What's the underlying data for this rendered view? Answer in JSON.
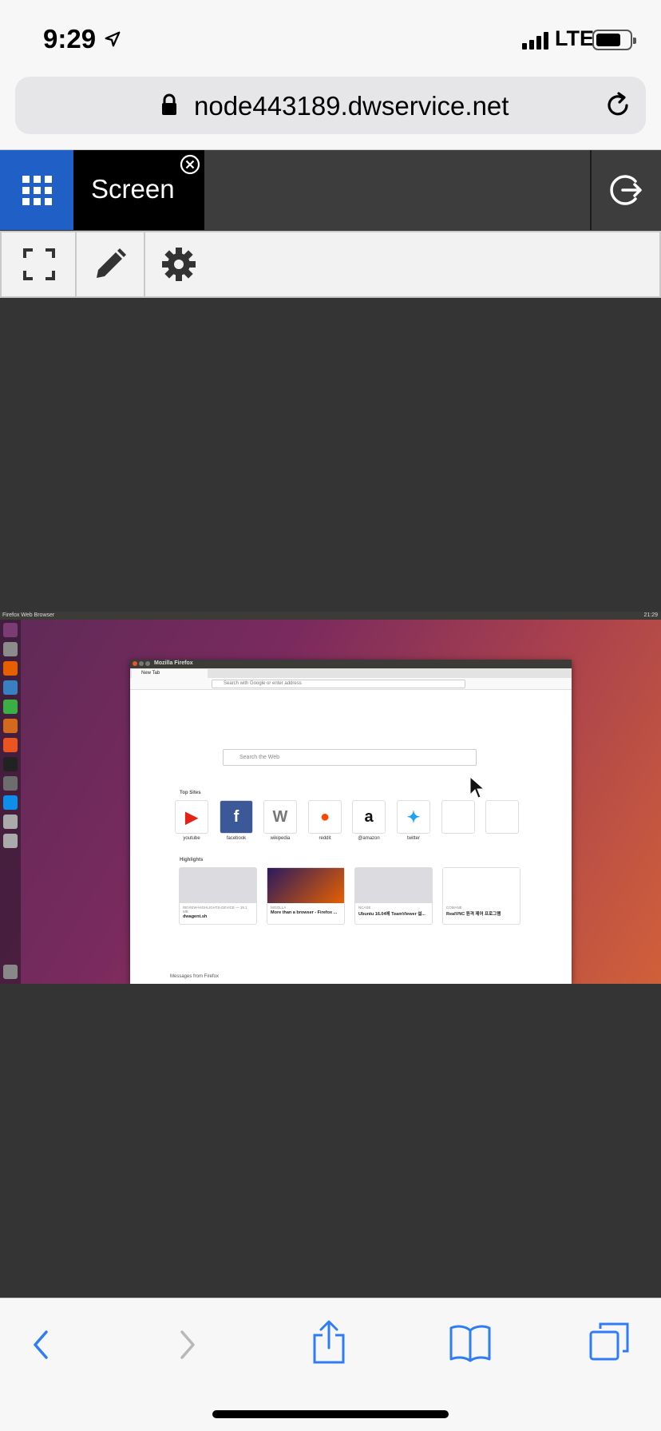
{
  "status_bar": {
    "time": "9:29",
    "network": "LTE"
  },
  "url_bar": {
    "url": "node443189.dwservice.net"
  },
  "app": {
    "active_tab": "Screen"
  },
  "remote_desktop": {
    "top_panel_title": "Firefox Web Browser",
    "top_panel_clock": "21:29",
    "window_title": "Mozilla Firefox",
    "tab_title": "New Tab",
    "address_placeholder": "Search with Google or enter address",
    "search_placeholder": "Search the Web",
    "top_sites_label": "Top Sites",
    "top_sites": [
      {
        "name": "youtube",
        "icon": "youtube-icon",
        "color": "#e62117"
      },
      {
        "name": "facebook",
        "icon": "facebook-icon",
        "color": "#3b5998"
      },
      {
        "name": "wikipedia",
        "icon": "wikipedia-icon",
        "color": "#777777"
      },
      {
        "name": "reddit",
        "icon": "reddit-icon",
        "color": "#ff4500"
      },
      {
        "name": "@amazon",
        "icon": "amazon-icon",
        "color": "#111111"
      },
      {
        "name": "twitter",
        "icon": "twitter-icon",
        "color": "#1da1f2"
      }
    ],
    "highlights_label": "Highlights",
    "highlights": [
      {
        "source": "REVIEW-HIGHLIGHTS-DEVICE — 19.1 MB",
        "title": "dwagent.sh"
      },
      {
        "source": "MOZILLA",
        "title": "More than a browser - Firefox ..."
      },
      {
        "source": "NCASE",
        "title": "Ubuntu 16.04에 TeamViewer 설..."
      },
      {
        "source": "COMANE",
        "title": "RealVNC 원격 제어 프로그램"
      }
    ],
    "messages_label": "Messages from Firefox"
  }
}
